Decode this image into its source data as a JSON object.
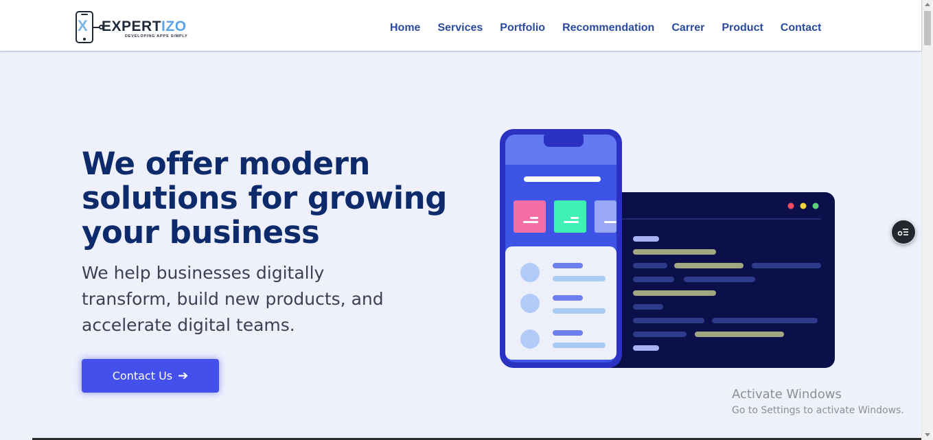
{
  "brand": {
    "logo_mark": "X",
    "name_part1": "EXPERT",
    "name_part2": "IZO",
    "tagline": "DEVELOPING APPS SIMPLY"
  },
  "nav": {
    "items": [
      {
        "label": "Home"
      },
      {
        "label": "Services"
      },
      {
        "label": "Portfolio"
      },
      {
        "label": "Recommendation"
      },
      {
        "label": "Carrer"
      },
      {
        "label": "Product"
      },
      {
        "label": "Contact"
      }
    ]
  },
  "hero": {
    "title": "We offer modern solutions for growing your business",
    "subtitle": "We help businesses digitally transform, build new products, and accelerate digital teams.",
    "cta_label": "Contact Us",
    "cta_icon": "arrow-right-icon"
  },
  "floating_button": {
    "icon": "menu-list-icon"
  },
  "os_overlay": {
    "line1": "Activate Windows",
    "line2": "Go to Settings to activate Windows."
  },
  "colors": {
    "accent": "#4450ec",
    "heading": "#0d2a6b",
    "nav_link": "#2a4a9e",
    "background": "#eef0fb"
  }
}
